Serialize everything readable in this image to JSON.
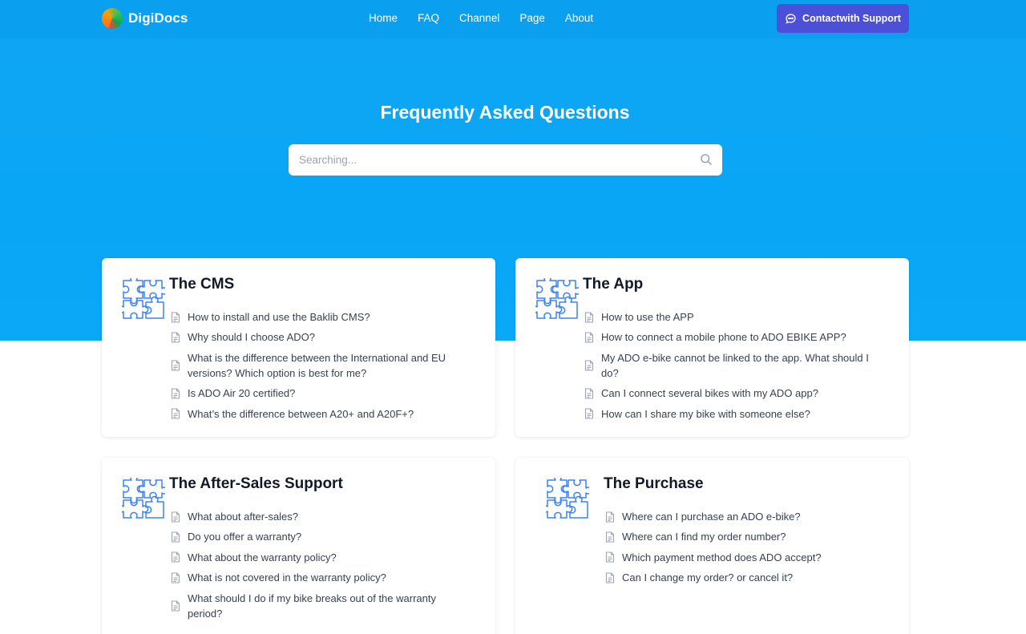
{
  "brand": {
    "name": "DigiDocs"
  },
  "nav": [
    "Home",
    "FAQ",
    "Channel",
    "Page",
    "About"
  ],
  "support_button": {
    "label": "Contactwith Support"
  },
  "hero": {
    "title": "Frequently Asked Questions"
  },
  "search": {
    "placeholder": "Searching..."
  },
  "cards": [
    {
      "title": "The CMS",
      "items": [
        "How to install and use the Baklib CMS?",
        "Why should I choose ADO?",
        "What is the difference between the International and EU versions? Which option is best for me?",
        "Is ADO Air 20 certified?",
        "What’s the difference between A20+ and A20F+?"
      ]
    },
    {
      "title": "The App",
      "items": [
        "How to use the APP",
        "How to connect a mobile phone to ADO EBIKE APP?",
        "My ADO e-bike cannot be linked to the app. What should I do?",
        "Can I connect several bikes with my ADO app?",
        "How can I share my bike with someone else?"
      ]
    },
    {
      "title": "The After-Sales Support",
      "items": [
        "What about after-sales?",
        "Do you offer a warranty?",
        "What about the warranty policy?",
        "What is not covered in the warranty policy?",
        "What should I do if my bike breaks out of the warranty period?"
      ]
    },
    {
      "title": "The Purchase",
      "items": [
        "Where can I purchase an ADO e-bike?",
        "Where can I find my order number?",
        "Which payment method does ADO accept?",
        "Can I change my order? or cancel it?"
      ]
    }
  ],
  "colors": {
    "hero": "#0aa6f6",
    "button": "#4c4fd8",
    "icon": "#3b82f6"
  },
  "icons": {
    "brand": "logo-icon",
    "search": "search-icon",
    "support": "chat-bubble-icon",
    "card": "puzzle-icon",
    "item": "document-icon"
  }
}
